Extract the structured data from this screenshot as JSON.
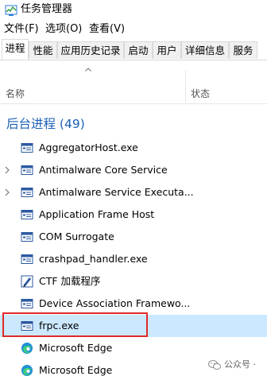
{
  "window": {
    "title": "任务管理器"
  },
  "menu": {
    "file": "文件(F)",
    "options": "选项(O)",
    "view": "查看(V)"
  },
  "tabs": {
    "processes": "进程",
    "performance": "性能",
    "app_history": "应用历史记录",
    "startup": "启动",
    "users": "用户",
    "details": "详细信息",
    "services": "服务"
  },
  "columns": {
    "name": "名称",
    "status": "状态"
  },
  "group": {
    "label": "后台进程 (49)"
  },
  "processes": [
    {
      "name": "AggregatorHost.exe",
      "icon": "window-app-icon",
      "expandable": false
    },
    {
      "name": "Antimalware Core Service",
      "icon": "window-app-icon",
      "expandable": true
    },
    {
      "name": "Antimalware Service Executa...",
      "icon": "window-app-icon",
      "expandable": true
    },
    {
      "name": "Application Frame Host",
      "icon": "window-app-icon",
      "expandable": false
    },
    {
      "name": "COM Surrogate",
      "icon": "window-app-icon",
      "expandable": false
    },
    {
      "name": "crashpad_handler.exe",
      "icon": "window-app-icon",
      "expandable": false
    },
    {
      "name": "CTF 加载程序",
      "icon": "ctf-pen-icon",
      "expandable": false
    },
    {
      "name": "Device Association Framewo...",
      "icon": "window-app-icon",
      "expandable": false
    },
    {
      "name": "frpc.exe",
      "icon": "window-app-icon",
      "expandable": false,
      "selected": true
    },
    {
      "name": "Microsoft Edge",
      "icon": "edge-icon",
      "expandable": false
    },
    {
      "name": "Microsoft Edge",
      "icon": "edge-icon",
      "expandable": false
    }
  ],
  "watermark": {
    "text": "公众号 ·"
  },
  "colors": {
    "group_header": "#1a5fb4",
    "selection": "#cce8ff",
    "highlight_border": "#e02a2a"
  }
}
